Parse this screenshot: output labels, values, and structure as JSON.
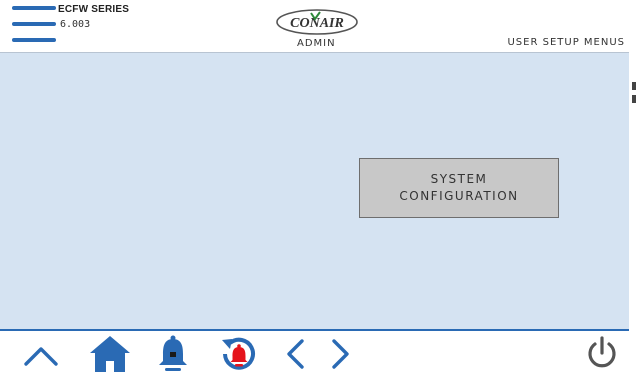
{
  "header": {
    "series": "ECFW SERIES",
    "version": "6.003",
    "logo_text": "CONAIR",
    "user_level": "ADMIN",
    "screen_title": "USER SETUP MENUS"
  },
  "main": {
    "system_configuration": {
      "line1": "SYSTEM",
      "line2": "CONFIGURATION"
    }
  },
  "colors": {
    "accent": "#2a6ab4",
    "background": "#d5e3f2",
    "button": "#c8c8c8",
    "alarm": "#e5141c"
  },
  "footer": {
    "icons": [
      "chevron-up-icon",
      "home-icon",
      "bell-icon",
      "alarm-history-icon",
      "chevron-left-icon",
      "chevron-right-icon",
      "power-icon"
    ]
  }
}
